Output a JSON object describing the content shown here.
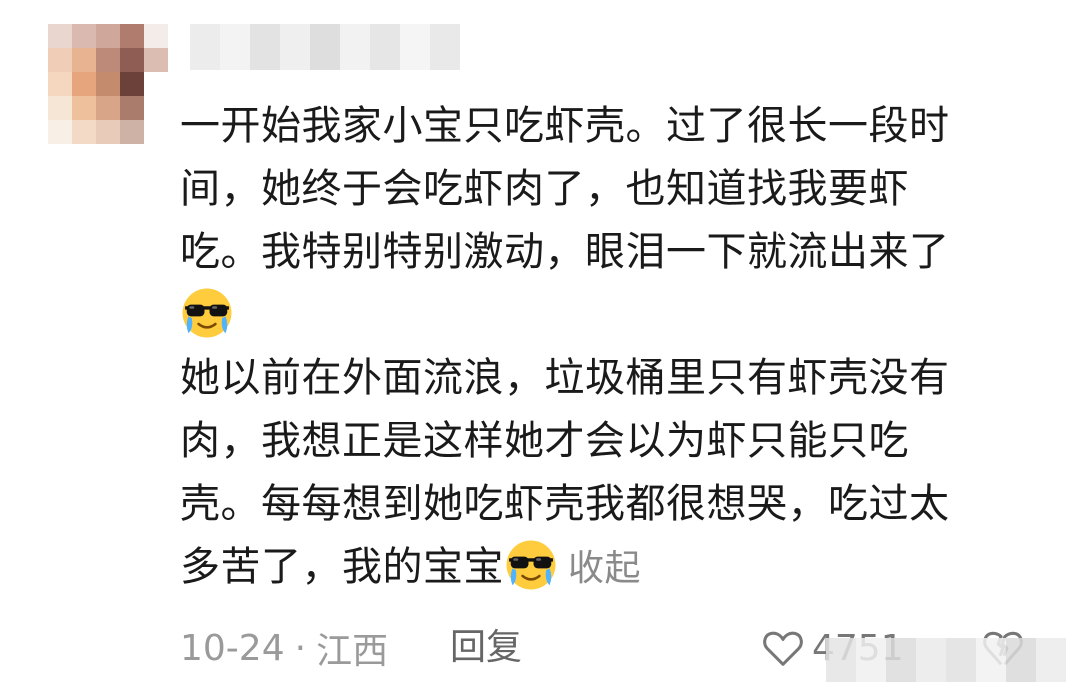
{
  "comment": {
    "body_lines": [
      "一开始我家小宝只吃虾壳。过了很长一段时",
      "间，她终于会吃虾肉了，也知道找我要虾",
      "吃。我特别特别激动，眼泪一下就流出来了"
    ],
    "body_lines_2": [
      "她以前在外面流浪，垃圾桶里只有虾壳没有",
      "肉，我想正是这样她才会以为虾只能只吃",
      "壳。每每想到她吃虾壳我都很想哭，吃过太"
    ],
    "last_line_text": "多苦了，我的宝宝",
    "collapse_label": "收起",
    "emoji_icon": "crying-sunglasses-emoji"
  },
  "footer": {
    "date": "10-24",
    "separator": "·",
    "location": "江西",
    "reply_label": "回复",
    "like_count": "4751",
    "like_icon": "heart-outline-icon",
    "dislike_icon": "broken-heart-outline-icon"
  },
  "colors": {
    "text": "#1a1a1a",
    "muted": "#9a9a9a",
    "collapse": "#8a8a8a",
    "background": "#ffffff"
  }
}
